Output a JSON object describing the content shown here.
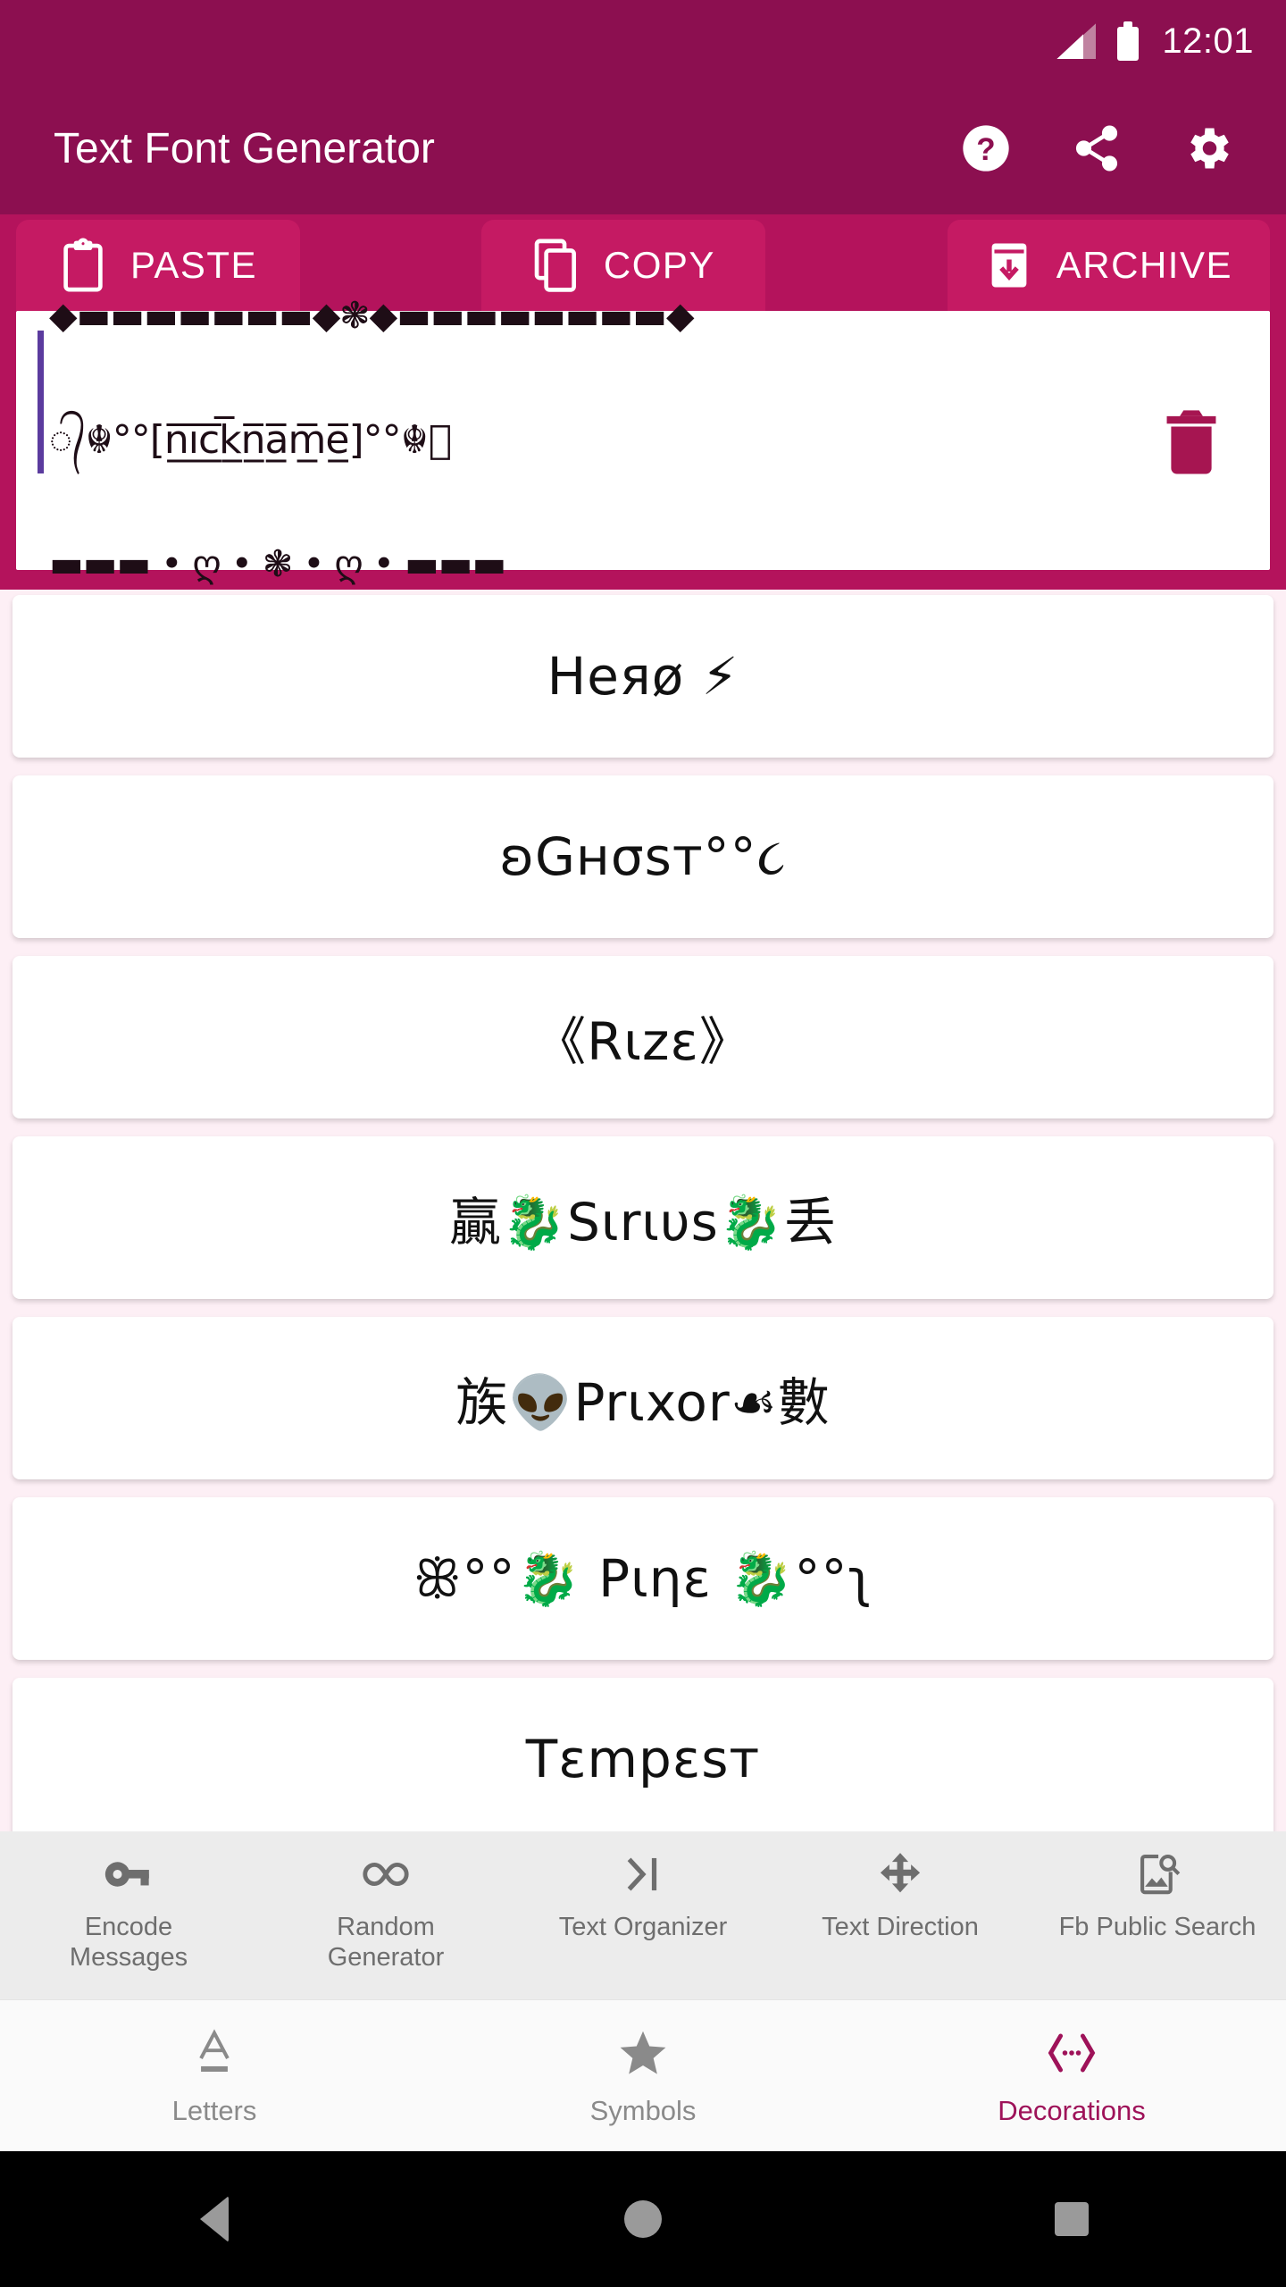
{
  "status_bar": {
    "time": "12:01",
    "signal_icon": "signal-bars-icon",
    "battery_icon": "battery-full-icon"
  },
  "app_bar": {
    "title": "Text Font Generator",
    "actions": [
      {
        "name": "help-icon",
        "label": "Help"
      },
      {
        "name": "share-icon",
        "label": "Share"
      },
      {
        "name": "settings-gear-icon",
        "label": "Settings"
      }
    ]
  },
  "action_row": {
    "buttons": [
      {
        "label": "PASTE",
        "icon": "clipboard-paste-icon"
      },
      {
        "label": "COPY",
        "icon": "copy-icon"
      },
      {
        "label": "ARCHIVE",
        "icon": "archive-download-icon"
      }
    ]
  },
  "input_field": {
    "line1": "◆▬▬▬▬▬▬▬◆❃◆▬▬▬▬▬▬▬▬◆",
    "line2": "᭄☬°°[n̲̅i̲̅c̲̅k̲̅n̲̅a̲̅m̲̅e̲̅]°°☬᭄",
    "line3": "▬▬▬ • ღ • ❃ • ღ • ▬▬▬",
    "caret_color": "#5b3b9e",
    "delete_icon": "trash-delete-icon"
  },
  "font_list": [
    {
      "text": "Heяø ⚡"
    },
    {
      "text": "ʚGнσsт°°૮"
    },
    {
      "text": "《Rιzε》"
    },
    {
      "text": "贏🐉Sιrιυs🐉丢"
    },
    {
      "text": "族👽Prιxor☙數"
    },
    {
      "text": "ꕥ°°🐉 Pιηε 🐉°°ʅ"
    },
    {
      "text": "Tεmpεsт"
    }
  ],
  "tools": [
    {
      "label": "Encode\nMessages",
      "label_line1": "Encode",
      "label_line2": "Messages",
      "icon": "key-icon"
    },
    {
      "label": "Random\nGenerator",
      "label_line1": "Random",
      "label_line2": "Generator",
      "icon": "infinity-icon"
    },
    {
      "label": "Text Organizer",
      "label_line1": "Text Organizer",
      "label_line2": "",
      "icon": "text-organizer-icon"
    },
    {
      "label": "Text Direction",
      "label_line1": "Text Direction",
      "label_line2": "",
      "icon": "four-way-arrows-icon"
    },
    {
      "label": "Fb Public Search",
      "label_line1": "Fb Public Search",
      "label_line2": "",
      "icon": "image-search-icon"
    }
  ],
  "bottom_nav": {
    "items": [
      {
        "label": "Letters",
        "icon": "letter-a-underline-icon",
        "active": false
      },
      {
        "label": "Symbols",
        "icon": "star-icon",
        "active": false
      },
      {
        "label": "Decorations",
        "icon": "angle-brackets-icon",
        "active": true
      }
    ],
    "active_color": "#9e1259",
    "inactive_color": "#8a8a8a"
  },
  "system_nav": {
    "back": "back-triangle-icon",
    "home": "home-circle-icon",
    "recents": "recents-square-icon"
  },
  "colors": {
    "app_bar": "#8c0f50",
    "action_row": "#b4135c",
    "action_button": "#c51a63",
    "page_background": "#fdeff5",
    "card": "#ffffff",
    "accent": "#9e1259"
  }
}
